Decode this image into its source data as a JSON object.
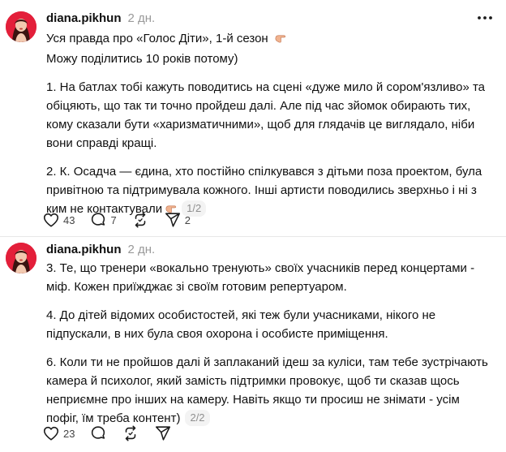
{
  "posts": [
    {
      "username": "diana.pikhun",
      "timestamp": "2 дн.",
      "paragraphs": [
        "Уся правда про «Голос Діти», 1-й сезон",
        "Можу поділитись 10 років потому)",
        "1. На батлах тобі кажуть поводитись на сцені «дуже мило й сором'язливо» та обіцяють, що так ти точно пройдеш далі. Але під час зйомок обирають тих, кому сказали бути «харизматичними», щоб для глядачів це виглядало, ніби вони справді кращі.",
        "2. К. Осадча — єдина, хто постійно спілкувався з дітьми поза проектом, була привітною та підтримувала кожного. Інші артисти поводились зверхньо і ні з ким не контактували"
      ],
      "page_indicator": "1/2",
      "stats": {
        "likes": "43",
        "replies": "7",
        "reposts": "",
        "shares": "2"
      }
    },
    {
      "username": "diana.pikhun",
      "timestamp": "2 дн.",
      "paragraphs": [
        "3. Те, що тренери «вокально тренують» своїх учасників перед концертами - міф. Кожен приїжджає зі своїм готовим репертуаром.",
        "4. До дітей відомих особистостей, які теж були учасниками, нікого не підпускали, в них була своя охорона і особисте приміщення.",
        "6. Коли ти не пройшов далі й заплаканий ідеш за куліси, там тебе зустрічають камера й психолог, який замість підтримки провокує, щоб ти сказав щось неприємне про інших на камеру. Навіть якщо ти просиш не знімати - усім пофіг, їм треба контент)"
      ],
      "page_indicator": "2/2",
      "stats": {
        "likes": "23",
        "replies": "",
        "reposts": "",
        "shares": ""
      }
    }
  ],
  "icons": {
    "more": "more-horizontal-icon",
    "like": "heart-icon",
    "reply": "comment-icon",
    "repost": "repost-icon",
    "share": "send-icon",
    "emoji": "pointing-hand-emoji"
  },
  "colors": {
    "text": "#101010",
    "muted": "#999999",
    "divider": "#e8e8e8",
    "avatar_bg": "#e31f3a"
  }
}
